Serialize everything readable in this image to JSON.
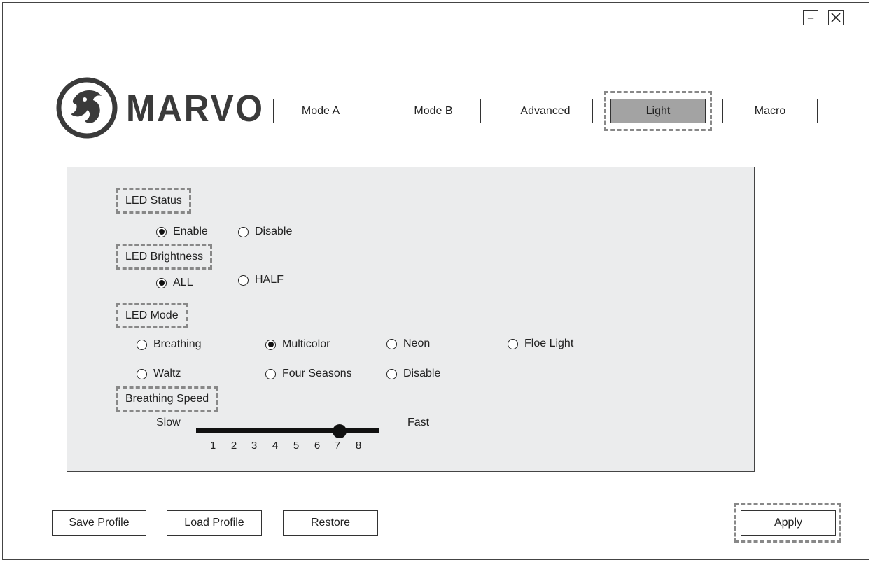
{
  "window": {
    "minimize_label": "–",
    "close_label": "✕",
    "minimize_icon": "minimize-icon",
    "close_icon": "close-icon"
  },
  "brand": {
    "logo_icon": "marvo-logo-icon",
    "name": "MARVO"
  },
  "tabs": [
    {
      "label": "Mode A",
      "active": false
    },
    {
      "label": "Mode B",
      "active": false
    },
    {
      "label": "Advanced",
      "active": false
    },
    {
      "label": "Light",
      "active": true
    },
    {
      "label": "Macro",
      "active": false
    }
  ],
  "led_status": {
    "title": "LED Status",
    "options": [
      {
        "label": "Enable",
        "selected": true
      },
      {
        "label": "Disable",
        "selected": false
      }
    ]
  },
  "led_brightness": {
    "title": "LED Brightness",
    "options": [
      {
        "label": "ALL",
        "selected": true
      },
      {
        "label": "HALF",
        "selected": false
      }
    ]
  },
  "led_mode": {
    "title": "LED Mode",
    "options": [
      {
        "label": "Breathing",
        "selected": false
      },
      {
        "label": "Multicolor",
        "selected": true
      },
      {
        "label": "Neon",
        "selected": false
      },
      {
        "label": "Floe Light",
        "selected": false
      },
      {
        "label": "Waltz",
        "selected": false
      },
      {
        "label": "Four Seasons",
        "selected": false
      },
      {
        "label": "Disable",
        "selected": false
      }
    ]
  },
  "breathing_speed": {
    "title": "Breathing Speed",
    "slow_label": "Slow",
    "fast_label": "Fast",
    "ticks": [
      "1",
      "2",
      "3",
      "4",
      "5",
      "6",
      "7",
      "8"
    ],
    "value": 7
  },
  "footer": {
    "save_label": "Save Profile",
    "load_label": "Load Profile",
    "restore_label": "Restore",
    "apply_label": "Apply"
  },
  "colors": {
    "active_tab": "#a3a3a3",
    "panel_bg": "#ebeced",
    "focus_dash": "#888888"
  }
}
